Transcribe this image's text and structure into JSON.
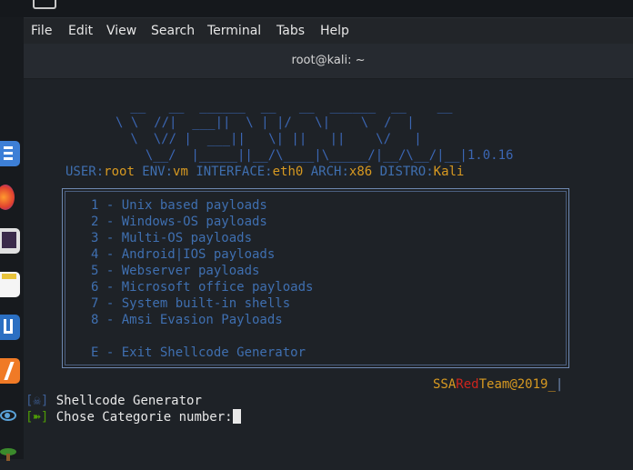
{
  "window": {
    "title": "root@kali: ~"
  },
  "menubar": {
    "items": [
      "File",
      "Edit",
      "View",
      "Search",
      "Terminal",
      "Tabs",
      "Help"
    ]
  },
  "dock": {
    "items": [
      "terminal-app-icon",
      "firefox-icon",
      "terminal-icon",
      "text-editor-icon",
      "metasploit-icon",
      "burpsuite-icon",
      "eye-icon",
      "tree-icon"
    ]
  },
  "banner": {
    "ascii": [
      " __   __  ______  __   __  ______  __    __ ",
      "\\ \\  //|  ___||  \\ | |/   \\|    \\  /  |",
      " \\  \\// |  ___||   \\| ||   ||    \\/   |",
      "  \\__/  |_____||__/\\____|\\_____/|__/\\__/|__|"
    ],
    "version": "1.0.16"
  },
  "env": {
    "user_label": "USER:",
    "user": "root",
    "env_label": " ENV:",
    "env": "vm",
    "iface_label": " INTERFACE:",
    "iface": "eth0",
    "arch_label": " ARCH:",
    "arch": "x86",
    "distro_label": " DISTRO:",
    "distro": "Kali"
  },
  "menu": {
    "options": [
      "1 - Unix based payloads",
      "2 - Windows-OS payloads",
      "3 - Multi-OS payloads",
      "4 - Android|IOS payloads",
      "5 - Webserver payloads",
      "6 - Microsoft office payloads",
      "7 - System built-in shells",
      "8 - Amsi Evasion Payloads"
    ],
    "exit": "E - Exit Shellcode Generator"
  },
  "signature": {
    "ssa": "SSA",
    "red": "Red",
    "team": "Team",
    "year": "@2019_",
    "bar": "|"
  },
  "prompt": {
    "line1_prefix": "[☠]",
    "line1_text": "Shellcode Generator",
    "line2_prefix": "[➽]",
    "line2_text": "Chose Categorie number:"
  },
  "colors": {
    "accent_blue": "#3f6fb0",
    "orange": "#d79921",
    "red": "#cc241d",
    "green": "#4e9a06"
  }
}
